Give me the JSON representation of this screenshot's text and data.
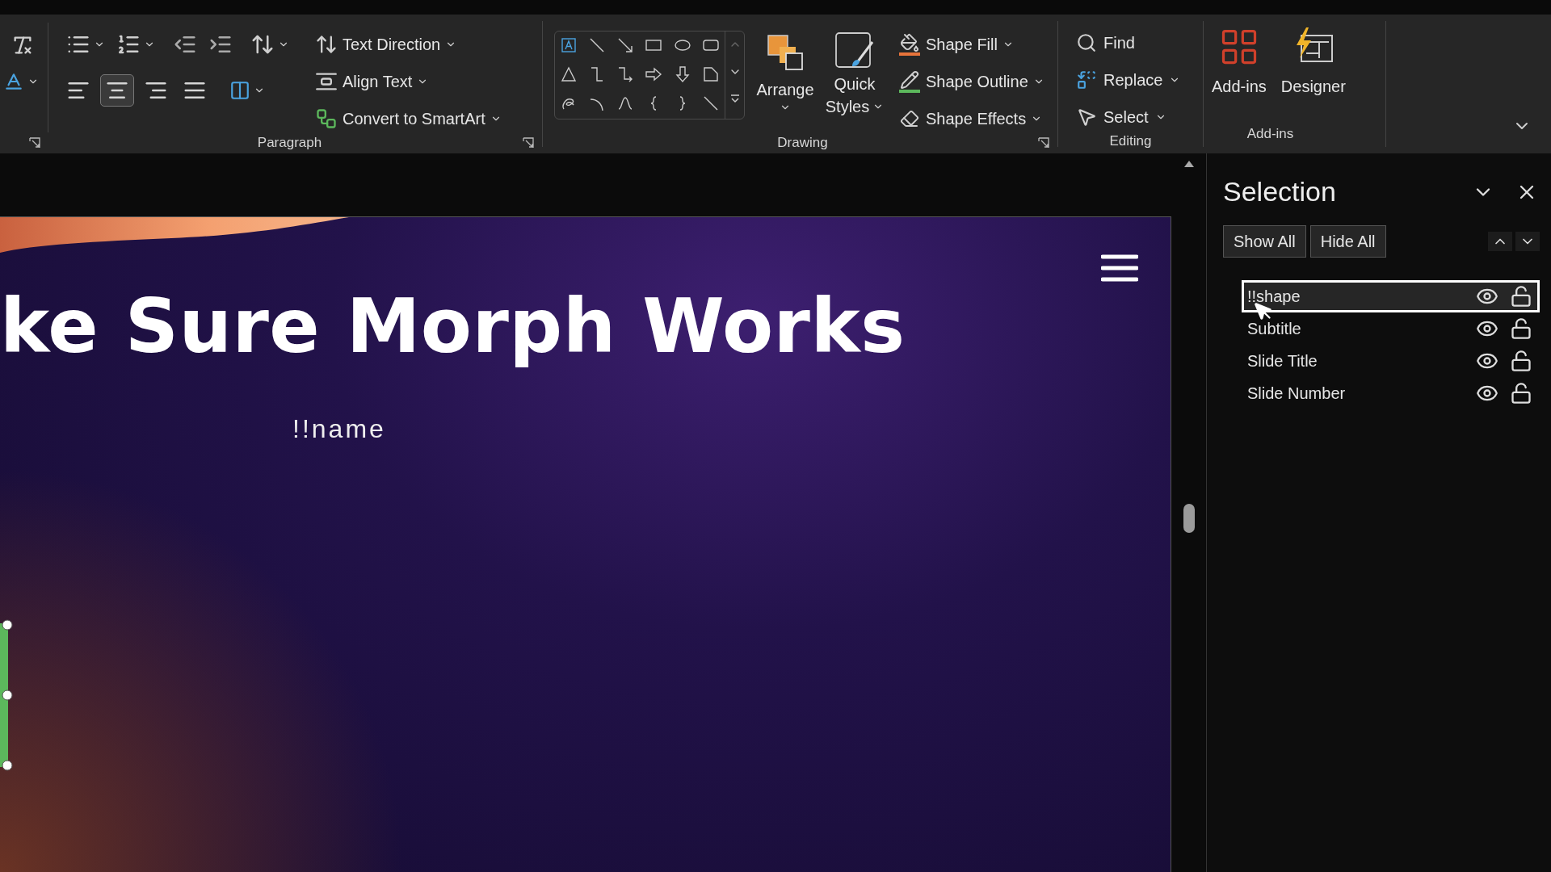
{
  "ribbon": {
    "paragraph": {
      "label": "Paragraph",
      "alignment": [
        {
          "selected": false
        },
        {
          "selected": true
        },
        {
          "selected": false
        },
        {
          "selected": false
        }
      ],
      "commands": [
        {
          "label": "Text Direction"
        },
        {
          "label": "Align Text"
        },
        {
          "label": "Convert to SmartArt"
        }
      ]
    },
    "drawing": {
      "label": "Drawing",
      "arrange": "Arrange",
      "quick_styles": [
        "Quick",
        "Styles"
      ],
      "format": [
        "Shape Fill",
        "Shape Outline",
        "Shape Effects"
      ]
    },
    "editing": {
      "label": "Editing",
      "items": [
        "Find",
        "Replace",
        "Select"
      ]
    },
    "addins": {
      "label": "Add-ins",
      "items": [
        "Add-ins",
        "Designer"
      ]
    }
  },
  "slide": {
    "title": "ke Sure Morph Works",
    "subtitle": "!!name"
  },
  "selection_pane": {
    "title": "Selection",
    "show_all": "Show All",
    "hide_all": "Hide All",
    "items": [
      {
        "name": "!!shape",
        "selected": true,
        "visible": true,
        "locked": false
      },
      {
        "name": "Subtitle",
        "selected": false,
        "visible": true,
        "locked": false
      },
      {
        "name": "Slide Title",
        "selected": false,
        "visible": true,
        "locked": false
      },
      {
        "name": "Slide Number",
        "selected": false,
        "visible": true,
        "locked": false
      }
    ]
  }
}
